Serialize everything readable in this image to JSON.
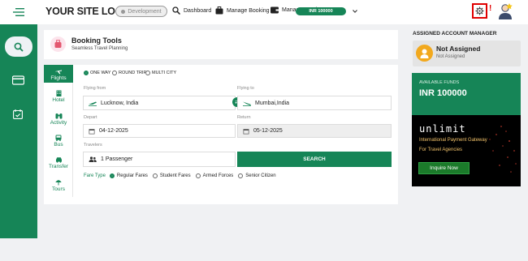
{
  "header": {
    "logo": "YOUR SITE LOGO",
    "environment": "Development",
    "nav": [
      {
        "label": "Dashboard",
        "icon": "search-icon"
      },
      {
        "label": "Manage Booking",
        "icon": "briefcase-icon"
      },
      {
        "label": "Manage Funds",
        "icon": "wallet-icon"
      }
    ],
    "funds_badge": "INR 100000",
    "alert_mark": "!"
  },
  "booking": {
    "title": "Booking Tools",
    "subtitle": "Seamless Travel Planning",
    "tabs": [
      {
        "label": "Flights",
        "icon": "plane-icon",
        "active": true
      },
      {
        "label": "Hotel",
        "icon": "hotel-icon",
        "active": false
      },
      {
        "label": "Activity",
        "icon": "binoculars-icon",
        "active": false
      },
      {
        "label": "Bus",
        "icon": "bus-icon",
        "active": false
      },
      {
        "label": "Transfer",
        "icon": "car-icon",
        "active": false
      },
      {
        "label": "Tours",
        "icon": "umbrella-icon",
        "active": false
      }
    ],
    "trip_types": [
      "ONE WAY",
      "ROUND TRIP",
      "MULTI CITY"
    ],
    "selected_trip_type": "ONE WAY",
    "flying_from_label": "Flying from",
    "flying_from_value": "Lucknow, India",
    "flying_to_label": "Flying to",
    "flying_to_value": "Mumbai,India",
    "depart_label": "Depart",
    "depart_value": "04-12-2025",
    "return_label": "Return",
    "return_value": "05-12-2025",
    "travelers_label": "Travelers",
    "travelers_value": "1 Passenger",
    "search_label": "SEARCH",
    "fare_type_label": "Fare Type",
    "fare_types": [
      "Regular Fares",
      "Student Fares",
      "Armed Forces",
      "Senior Citizen"
    ],
    "selected_fare": "Regular Fares"
  },
  "account_manager": {
    "heading": "ASSIGNED ACCOUNT MANAGER",
    "name": "Not Assigned",
    "sub": "Not Assigned"
  },
  "funds": {
    "label": "AVAILABLE FUNDS",
    "value": "INR 100000"
  },
  "ad": {
    "brand": "unlimit",
    "line1": "International Payment Gateway",
    "line2": "For Travel Agencies",
    "button": "Inquire Now"
  },
  "colors": {
    "brand_green": "#168557",
    "alert_red": "#e00000"
  }
}
